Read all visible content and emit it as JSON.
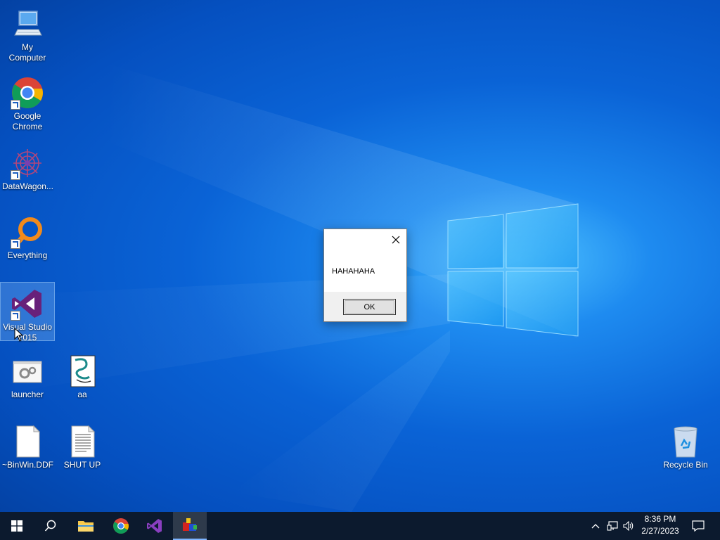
{
  "desktop": {
    "icons": [
      {
        "label": "My Computer",
        "icon": "computer-icon"
      },
      {
        "label": "Google Chrome",
        "icon": "chrome-icon"
      },
      {
        "label": "DataWagon...",
        "icon": "datawagon-icon"
      },
      {
        "label": "Everything",
        "icon": "everything-search-icon"
      },
      {
        "label": "Visual Studio 2015",
        "icon": "visual-studio-icon"
      },
      {
        "label": "launcher",
        "icon": "launcher-gear-icon"
      },
      {
        "label": "aa",
        "icon": "script-file-icon"
      },
      {
        "label": "~BinWin.DDF",
        "icon": "blank-file-icon"
      },
      {
        "label": "SHUT UP",
        "icon": "text-file-icon"
      },
      {
        "label": "Recycle Bin",
        "icon": "recycle-bin-icon"
      }
    ]
  },
  "dialog": {
    "message": "HAHAHAHA",
    "ok_label": "OK",
    "close_icon": "close-icon"
  },
  "taskbar": {
    "start_icon": "windows-start-icon",
    "search_icon": "search-icon",
    "pinned": [
      "file-explorer-icon",
      "chrome-icon",
      "visual-studio-icon",
      "running-app-icon"
    ],
    "tray_icons": [
      "chevron-up-icon",
      "network-icon",
      "volume-icon"
    ],
    "time": "8:36 PM",
    "date": "2/27/2023",
    "notification_icon": "notification-icon"
  },
  "colors": {
    "taskbar": "#0c1a2e",
    "desktop_blue": "#0a63d6",
    "vs_purple": "#68217a"
  }
}
